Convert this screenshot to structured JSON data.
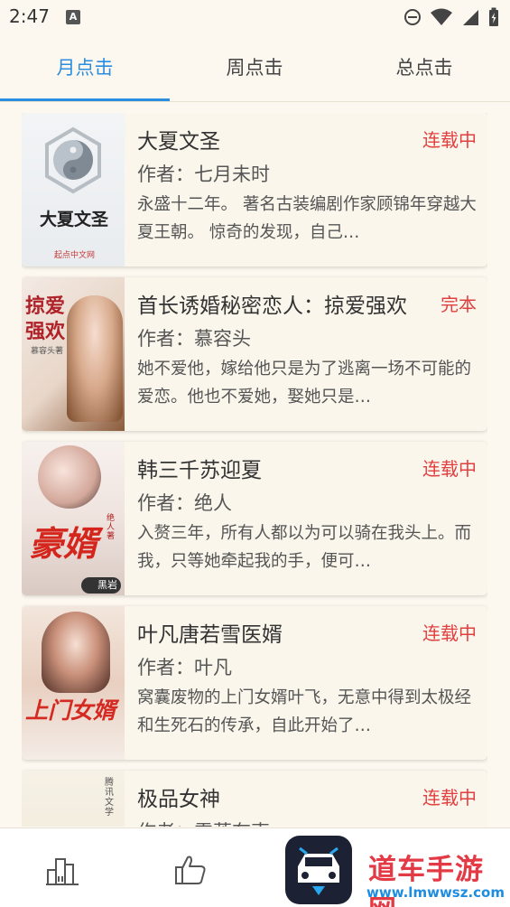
{
  "status_bar": {
    "time": "2:47",
    "notification_badge": "A"
  },
  "tabs": [
    {
      "label": "月点击",
      "active": true
    },
    {
      "label": "周点击",
      "active": false
    },
    {
      "label": "总点击",
      "active": false
    }
  ],
  "books": [
    {
      "title": "大夏文圣",
      "status": "连载中",
      "author": "作者：七月未时",
      "description": "永盛十二年。 著名古装编剧作家顾锦年穿越大夏王朝。 惊奇的发现，自己…",
      "cover_text": "大夏文圣",
      "cover_publisher": "起点中文网"
    },
    {
      "title": "首长诱婚秘密恋人：掠爱强欢",
      "status": "完本",
      "author": "作者：慕容头",
      "description": "她不爱他，嫁给他只是为了逃离一场不可能的爱恋。他也不爱她，娶她只是…",
      "cover_text_line1": "掠爱",
      "cover_text_line2": "强欢",
      "cover_author": "慕容头著"
    },
    {
      "title": "韩三千苏迎夏",
      "status": "连载中",
      "author": "作者：绝人",
      "description": "入赘三年，所有人都以为可以骑在我头上。而我，只等她牵起我的手，便可…",
      "cover_text": "豪婿",
      "cover_author": "绝人著",
      "cover_badge": "黑岩"
    },
    {
      "title": "叶凡唐若雪医婿",
      "status": "连载中",
      "author": "作者：叶凡",
      "description": "窝囊废物的上门女婿叶飞，无意中得到太极经和生死石的传承，自此开始了…",
      "cover_text": "上门女婿"
    },
    {
      "title": "极品女神",
      "status": "连载中",
      "author": "作者：雪落有声",
      "description": "",
      "cover_text": "腾讯文学"
    }
  ],
  "bottom_nav": {
    "items": [
      "ranking-icon",
      "thumbs-up-icon"
    ],
    "watermark_title": "道车手游网",
    "watermark_url": "www.lmwwsz.com"
  },
  "colors": {
    "accent": "#2a8de0",
    "status_red": "#e04040",
    "background": "#fdf8ef"
  }
}
